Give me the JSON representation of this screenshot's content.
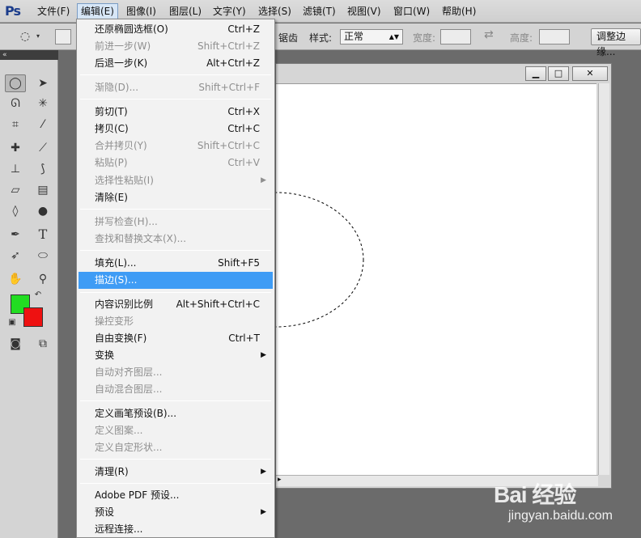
{
  "app": {
    "logo": "Ps"
  },
  "menubar": [
    {
      "label": "文件(F)"
    },
    {
      "label": "编辑(E)"
    },
    {
      "label": "图像(I)"
    },
    {
      "label": "图层(L)"
    },
    {
      "label": "文字(Y)"
    },
    {
      "label": "选择(S)"
    },
    {
      "label": "滤镜(T)"
    },
    {
      "label": "视图(V)"
    },
    {
      "label": "窗口(W)"
    },
    {
      "label": "帮助(H)"
    }
  ],
  "options_bar": {
    "feather_partial": "锯齿",
    "style_label": "样式:",
    "style_value": "正常",
    "width_label": "宽度:",
    "height_label": "高度:",
    "refine_button": "调整边缘..."
  },
  "edit_menu": {
    "items": [
      {
        "label": "还原椭圆选框(O)",
        "shortcut": "Ctrl+Z",
        "disabled": false
      },
      {
        "label": "前进一步(W)",
        "shortcut": "Shift+Ctrl+Z",
        "disabled": true
      },
      {
        "label": "后退一步(K)",
        "shortcut": "Alt+Ctrl+Z",
        "disabled": false
      },
      {
        "label": "渐隐(D)...",
        "shortcut": "Shift+Ctrl+F",
        "disabled": true
      },
      {
        "label": "剪切(T)",
        "shortcut": "Ctrl+X",
        "disabled": false
      },
      {
        "label": "拷贝(C)",
        "shortcut": "Ctrl+C",
        "disabled": false
      },
      {
        "label": "合并拷贝(Y)",
        "shortcut": "Shift+Ctrl+C",
        "disabled": true
      },
      {
        "label": "粘贴(P)",
        "shortcut": "Ctrl+V",
        "disabled": true
      },
      {
        "label": "选择性粘贴(I)",
        "shortcut": "",
        "disabled": true,
        "submenu": true
      },
      {
        "label": "清除(E)",
        "shortcut": "",
        "disabled": false
      },
      {
        "label": "拼写检查(H)...",
        "shortcut": "",
        "disabled": true
      },
      {
        "label": "查找和替换文本(X)...",
        "shortcut": "",
        "disabled": true
      },
      {
        "label": "填充(L)...",
        "shortcut": "Shift+F5",
        "disabled": false
      },
      {
        "label": "描边(S)...",
        "shortcut": "",
        "disabled": false,
        "highlighted": true
      },
      {
        "label": "内容识别比例",
        "shortcut": "Alt+Shift+Ctrl+C",
        "disabled": false
      },
      {
        "label": "操控变形",
        "shortcut": "",
        "disabled": true
      },
      {
        "label": "自由变换(F)",
        "shortcut": "Ctrl+T",
        "disabled": false
      },
      {
        "label": "变换",
        "shortcut": "",
        "disabled": false,
        "submenu": true
      },
      {
        "label": "自动对齐图层...",
        "shortcut": "",
        "disabled": true
      },
      {
        "label": "自动混合图层...",
        "shortcut": "",
        "disabled": true
      },
      {
        "label": "定义画笔预设(B)...",
        "shortcut": "",
        "disabled": false
      },
      {
        "label": "定义图案...",
        "shortcut": "",
        "disabled": true
      },
      {
        "label": "定义自定形状...",
        "shortcut": "",
        "disabled": true
      },
      {
        "label": "清理(R)",
        "shortcut": "",
        "disabled": false,
        "submenu": true
      },
      {
        "label": "Adobe PDF 预设...",
        "shortcut": "",
        "disabled": false
      },
      {
        "label": "预设",
        "shortcut": "",
        "disabled": false,
        "submenu": true
      },
      {
        "label": "远程连接...",
        "shortcut": "",
        "disabled": false
      }
    ]
  },
  "colors": {
    "foreground": "#22dd22",
    "background": "#ee1111",
    "highlight": "#3f9cf5"
  },
  "watermark": {
    "logo_text": "Bai 经验",
    "url": "jingyan.baidu.com"
  }
}
